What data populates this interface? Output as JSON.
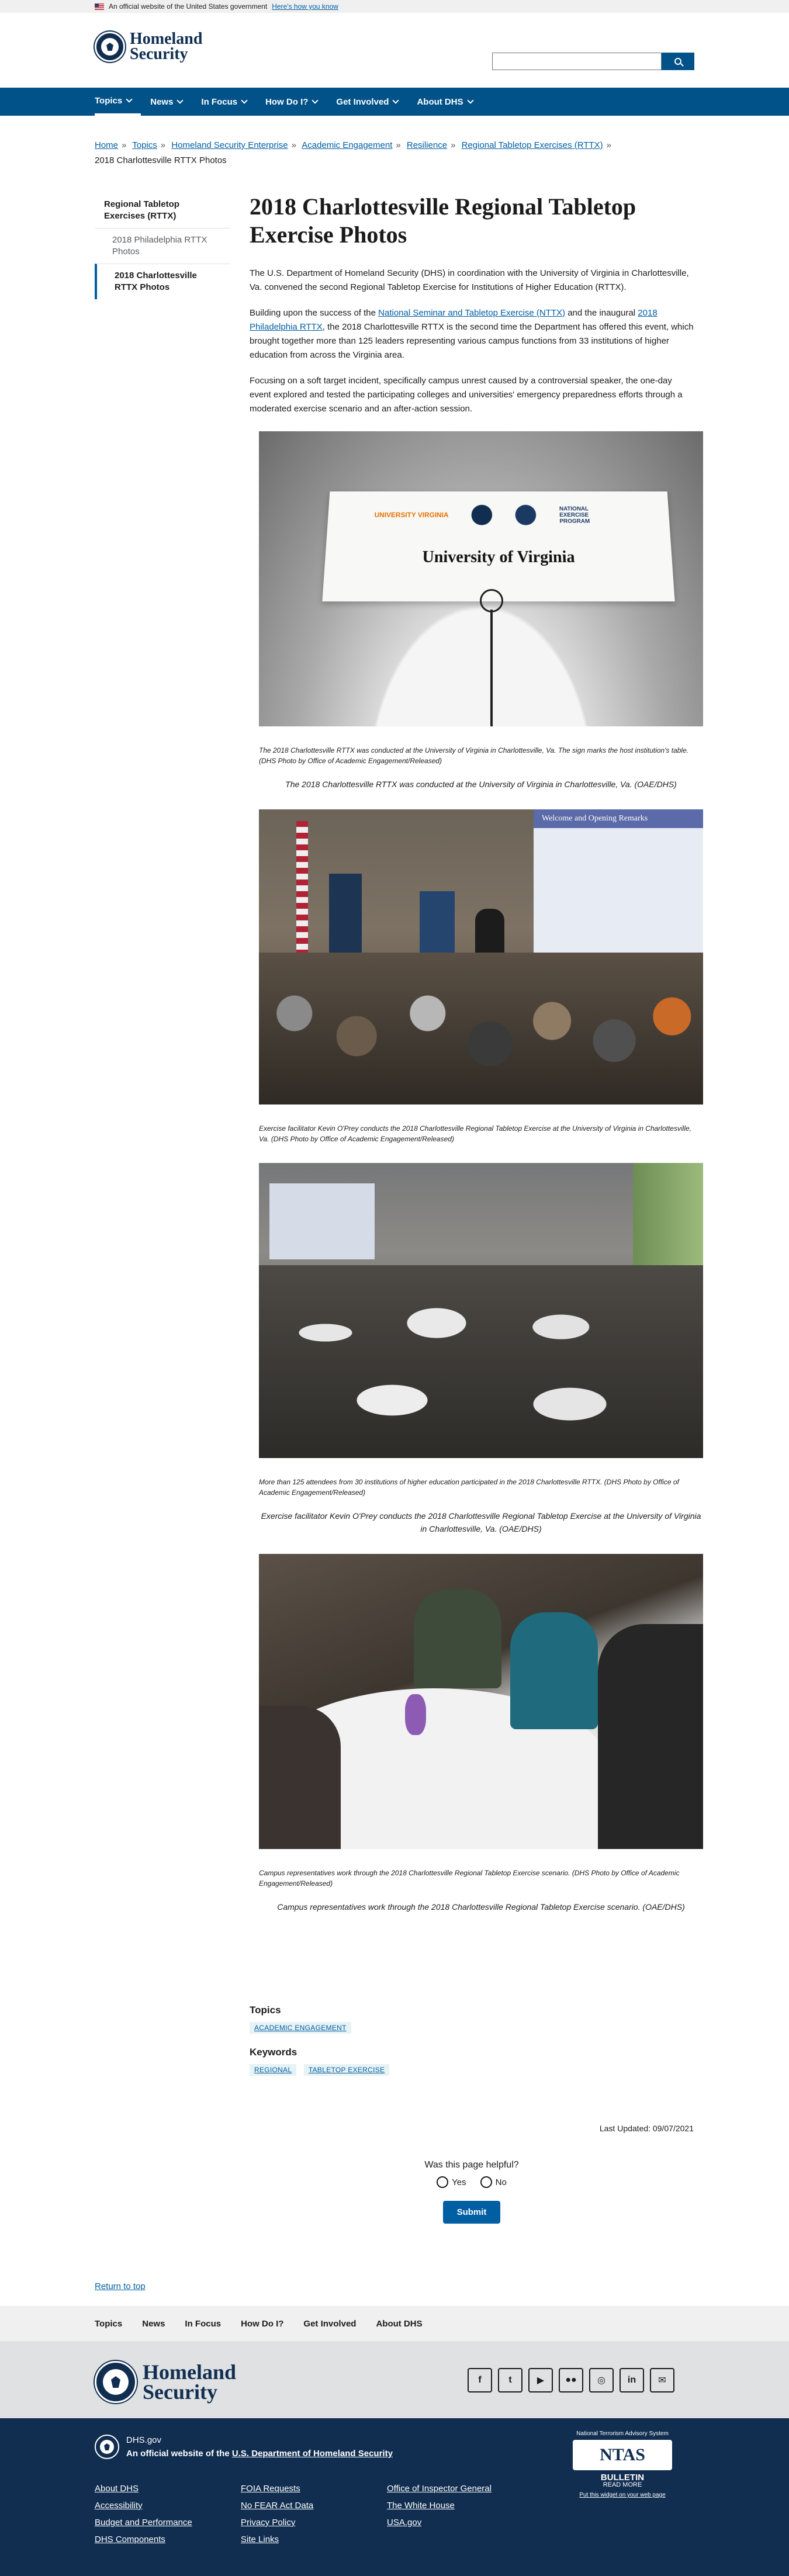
{
  "gov_banner": {
    "text": "An official website of the United States government",
    "toggle": "Here's how you know"
  },
  "header": {
    "logo_line1": "Homeland",
    "logo_line2": "Security",
    "search_placeholder": ""
  },
  "nav": {
    "items": [
      {
        "label": "Topics"
      },
      {
        "label": "News"
      },
      {
        "label": "In Focus"
      },
      {
        "label": "How Do I?"
      },
      {
        "label": "Get Involved"
      },
      {
        "label": "About DHS"
      }
    ]
  },
  "breadcrumb": {
    "items": [
      "Home",
      "Topics",
      "Homeland Security Enterprise",
      "Academic Engagement",
      "Resilience",
      "Regional Tabletop Exercises (RTTX)"
    ],
    "current": "2018 Charlottesville RTTX Photos"
  },
  "sidenav": {
    "parent": "Regional Tabletop Exercises (RTTX)",
    "child1": "2018 Philadelphia RTTX Photos",
    "current": "2018 Charlottesville RTTX Photos"
  },
  "page": {
    "title": "2018 Charlottesville Regional Tabletop Exercise Photos",
    "p1": "The U.S. Department of Homeland Security (DHS) in coordination with the University of Virginia in Charlottesville, Va. convened the second Regional Tabletop Exercise for Institutions of Higher Education (RTTX).",
    "p2_a": "Building upon the success of the ",
    "p2_link1": "National Seminar and Tabletop Exercise (NTTX)",
    "p2_b": " and the inaugural ",
    "p2_link2": "2018 Philadelphia RTTX",
    "p2_c": ", the 2018 Charlottesville RTTX is the second time the Department has offered this event, which brought together more than 125 leaders representing various campus functions from 33 institutions of higher education from across the Virginia area.",
    "p3": "Focusing on a soft target incident, specifically campus unrest caused by a controversial speaker, the one-day event explored and tested the participating colleges and universities' emergency preparedness efforts through a moderated exercise scenario and an after-action session."
  },
  "photos": [
    {
      "sign_logo1": "UNIVERSITY VIRGINIA",
      "sign_logo3": "NATIONAL EXERCISE PROGRAM",
      "sign_text": "University of Virginia",
      "caption_small": "The 2018 Charlottesville RTTX was conducted at the University of Virginia in Charlottesville, Va. The sign marks the host institution's table. (DHS Photo by Office of Academic Engagement/Released)",
      "caption_large": "The 2018 Charlottesville RTTX was conducted at the University of Virginia in Charlottesville, Va. (OAE/DHS)"
    },
    {
      "screen_title": "Welcome and Opening Remarks",
      "caption_small": "Exercise facilitator Kevin O'Prey conducts the 2018 Charlottesville Regional Tabletop Exercise at the University of Virginia in Charlottesville, Va. (DHS Photo by Office of Academic Engagement/Released)"
    },
    {
      "caption_small": "More than 125 attendees from 30 institutions of higher education participated in the 2018 Charlottesville RTTX. (DHS Photo by Office of Academic Engagement/Released)",
      "caption_large": "Exercise facilitator Kevin O'Prey conducts the 2018 Charlottesville Regional Tabletop Exercise at the University of Virginia in Charlottesville, Va. (OAE/DHS)"
    },
    {
      "caption_small": "Campus representatives work through the 2018 Charlottesville Regional Tabletop Exercise scenario. (DHS Photo by Office of Academic Engagement/Released)",
      "caption_large": "Campus representatives work through the 2018 Charlottesville Regional Tabletop Exercise scenario. (OAE/DHS)"
    }
  ],
  "topics": {
    "heading": "Topics",
    "tags": [
      "ACADEMIC ENGAGEMENT"
    ]
  },
  "keywords": {
    "heading": "Keywords",
    "tags": [
      "REGIONAL",
      "TABLETOP EXERCISE"
    ]
  },
  "last_updated": "Last Updated: 09/07/2021",
  "feedback": {
    "question": "Was this page helpful?",
    "yes": "Yes",
    "no": "No",
    "submit": "Submit"
  },
  "return_top": "Return to top",
  "footer_nav": [
    "Topics",
    "News",
    "In Focus",
    "How Do I?",
    "Get Involved",
    "About DHS"
  ],
  "footer": {
    "logo_line1": "Homeland",
    "logo_line2": "Security",
    "domain": "DHS.gov",
    "official_prefix": "An official website of the ",
    "official_link": "U.S. Department of Homeland Security",
    "links": [
      "About DHS",
      "FOIA Requests",
      "Office of Inspector General",
      "Accessibility",
      "No FEAR Act Data",
      "The White House",
      "Budget and Performance",
      "Privacy Policy",
      "USA.gov",
      "DHS Components",
      "Site Links"
    ],
    "ntas": {
      "system": "National Terrorism Advisory System",
      "title": "NTAS",
      "bulletin": "BULLETIN",
      "read_more": "READ MORE",
      "widget": "Put this widget on your web page"
    }
  }
}
